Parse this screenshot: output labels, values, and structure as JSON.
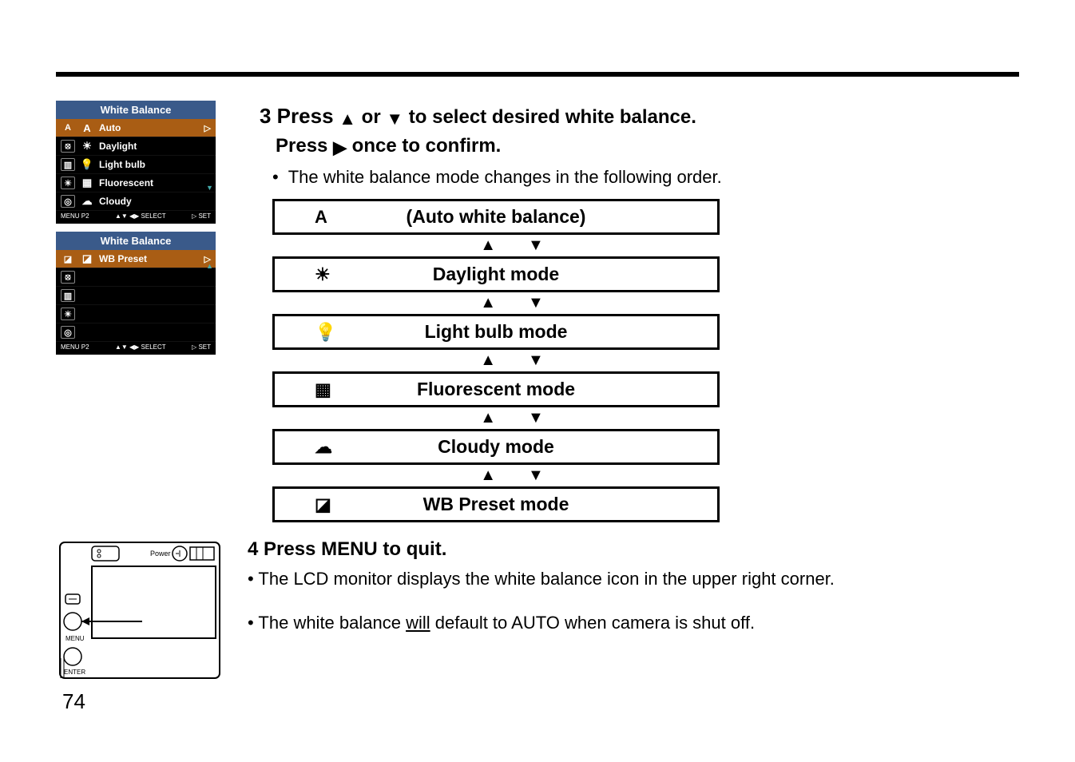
{
  "page_number": "74",
  "menu1": {
    "title": "White Balance",
    "items": [
      {
        "cell": "A",
        "glyph": "A",
        "label": "Auto",
        "selected": true
      },
      {
        "cell": "⦻",
        "glyph": "☀",
        "label": "Daylight",
        "selected": false
      },
      {
        "cell": "▥",
        "glyph": "💡",
        "label": "Light bulb",
        "selected": false
      },
      {
        "cell": "☀",
        "glyph": "▦",
        "label": "Fluorescent",
        "selected": false
      },
      {
        "cell": "◎",
        "glyph": "☁",
        "label": "Cloudy",
        "selected": false
      }
    ],
    "footer_left": "MENU P2",
    "footer_mid": "▲▼  ◀▶  SELECT",
    "footer_right": "▷ SET",
    "scroll_down": "▼"
  },
  "menu2": {
    "title": "White Balance",
    "items": [
      {
        "cell": "◪",
        "glyph": "◪",
        "label": "WB Preset",
        "selected": true
      },
      {
        "cell": "⦻",
        "glyph": "",
        "label": "",
        "selected": false
      },
      {
        "cell": "▥",
        "glyph": "",
        "label": "",
        "selected": false
      },
      {
        "cell": "☀",
        "glyph": "",
        "label": "",
        "selected": false
      },
      {
        "cell": "◎",
        "glyph": "",
        "label": "",
        "selected": false
      }
    ],
    "footer_left": "MENU P2",
    "footer_mid": "▲▼  ◀▶  SELECT",
    "footer_right": "▷ SET",
    "scroll_up": "▲"
  },
  "step3": {
    "line1_prefix": "3 Press",
    "up": "▲",
    "or": "or",
    "down": "▼",
    "line1_suffix": "to select desired white balance.",
    "line2_prefix": "Press",
    "right": "▶",
    "line2_suffix": "once to confirm.",
    "bullet": "The white balance mode changes in the following order."
  },
  "modes": [
    {
      "glyph": "A",
      "label": "(Auto white balance)"
    },
    {
      "glyph": "☀",
      "label": "Daylight  mode"
    },
    {
      "glyph": "💡",
      "label": "Light bulb mode"
    },
    {
      "glyph": "▦",
      "label": "Fluorescent mode"
    },
    {
      "glyph": "☁",
      "label": "Cloudy mode"
    },
    {
      "glyph": "◪",
      "label": "WB Preset mode"
    }
  ],
  "mode_arrow_up": "▲",
  "mode_arrow_down": "▼",
  "step4": {
    "heading": "4 Press MENU to quit.",
    "line1": "• The LCD monitor displays the white balance icon in the upper right corner.",
    "line2_pre": "• The white balance ",
    "line2_u": "will",
    "line2_post": " default to AUTO when camera is shut off."
  },
  "camera_labels": {
    "power": "Power",
    "menu": "MENU",
    "enter": "ENTER"
  }
}
